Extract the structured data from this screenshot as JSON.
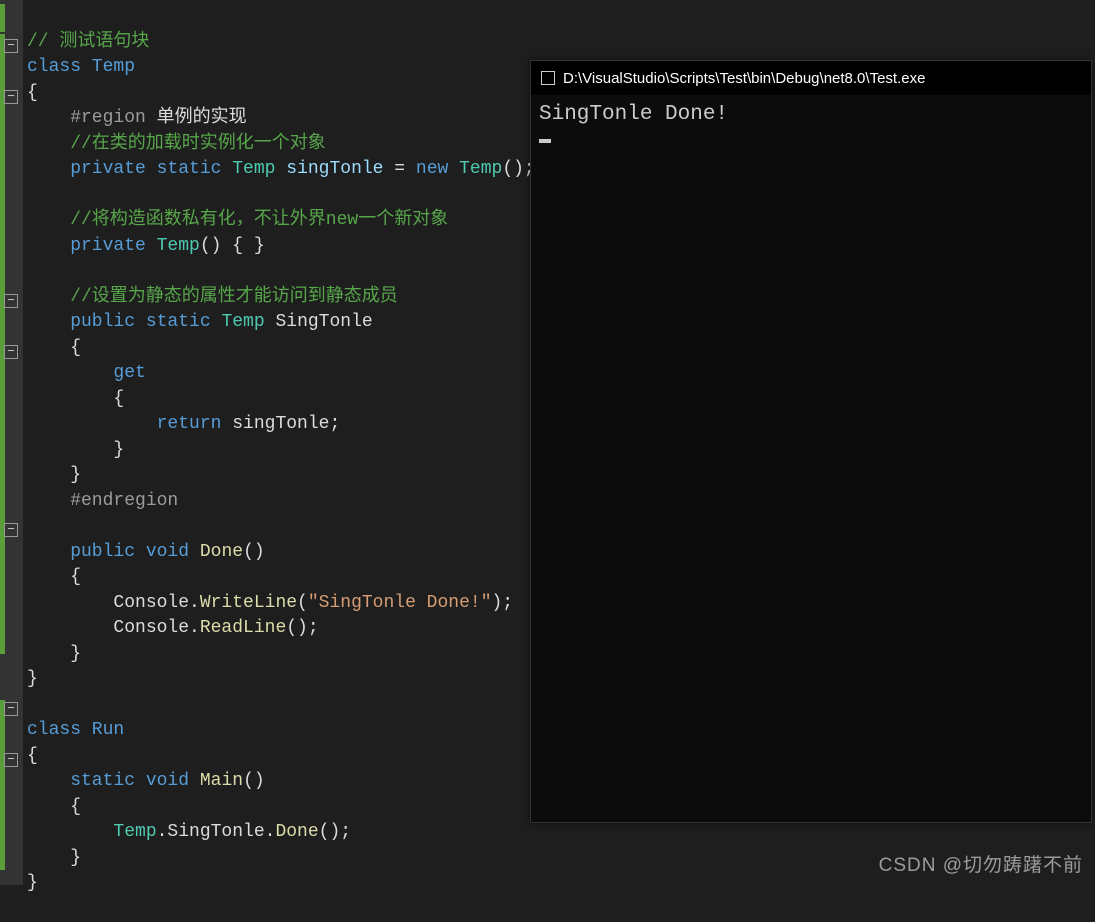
{
  "code": {
    "c0": "// 测试语句块",
    "c1": "class Temp",
    "c2": "{",
    "c3_rg": "    #region",
    "c3_tx": " 单例的实现",
    "c4": "    //在类的加载时实例化一个对象",
    "c5a": "    private",
    "c5b": " static",
    "c5c": " Temp",
    "c5d": " singTonle",
    "c5e": " = ",
    "c5f": "new",
    "c5g": " Temp",
    "c5h": "();",
    "c7": "    //将构造函数私有化，不让外界new一个新对象",
    "c8a": "    private",
    "c8b": " Temp",
    "c8c": "() { }",
    "c10": "    //设置为静态的属性才能访问到静态成员",
    "c11a": "    public",
    "c11b": " static",
    "c11c": " Temp",
    "c11d": " SingTonle",
    "c12": "    {",
    "c13a": "        ",
    "c13b": "get",
    "c14": "        {",
    "c15a": "            ",
    "c15b": "return",
    "c15c": " singTonle;",
    "c16": "        }",
    "c17": "    }",
    "c18": "    #endregion",
    "c20a": "    public",
    "c20b": " void",
    "c20c": " Done",
    "c20d": "()",
    "c21": "    {",
    "c22a": "        Console.",
    "c22b": "WriteLine",
    "c22c": "(",
    "c22d": "\"SingTonle Done!\"",
    "c22e": ");",
    "c23a": "        Console.",
    "c23b": "ReadLine",
    "c23c": "();",
    "c24": "    }",
    "c25": "}",
    "c27": "class Run",
    "c28": "{",
    "c29a": "    static",
    "c29b": " void",
    "c29c": " Main",
    "c29d": "()",
    "c30": "    {",
    "c31a": "        Temp",
    "c31b": ".SingTonle.",
    "c31c": "Done",
    "c31d": "();",
    "c32": "    }",
    "c33": "}"
  },
  "console": {
    "title": "D:\\VisualStudio\\Scripts\\Test\\bin\\Debug\\net8.0\\Test.exe",
    "output": "SingTonle Done!"
  },
  "watermark": "CSDN @切勿踌躇不前",
  "fold": {
    "minus": "−"
  }
}
